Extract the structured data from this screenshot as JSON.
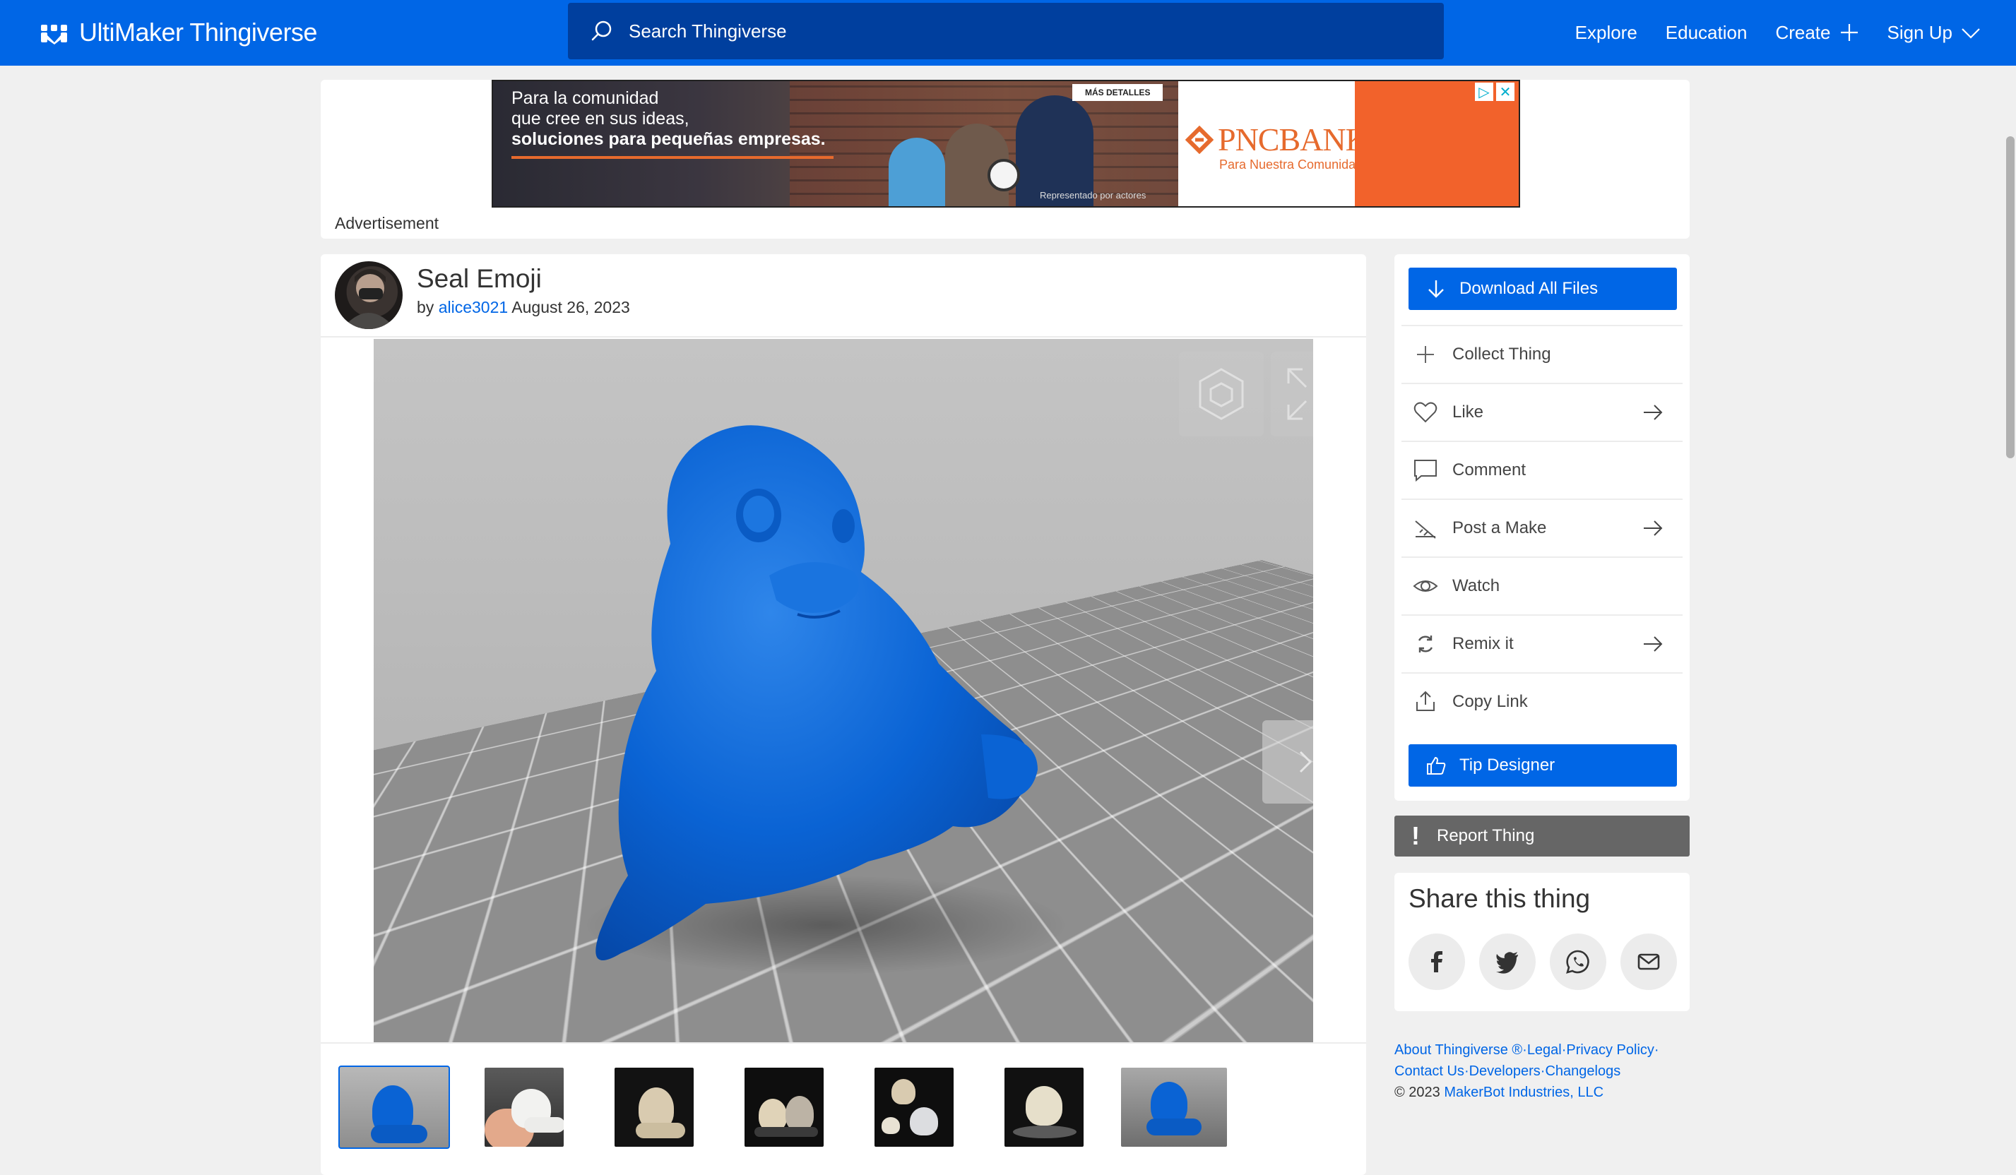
{
  "header": {
    "logo_text": "UltiMaker Thingiverse",
    "search_placeholder": "Search Thingiverse",
    "nav": {
      "explore": "Explore",
      "education": "Education",
      "create": "Create",
      "signup": "Sign Up"
    },
    "brand_color": "#0066e6"
  },
  "ad": {
    "line1": "Para la comunidad",
    "line2": "que cree en sus ideas,",
    "line3": "soluciones para pequeñas empresas.",
    "more_details": "MÁS DETALLES",
    "disclaimer": "Representado por actores",
    "brand": "PNCBANK",
    "brand_tagline": "Para Nuestra Comunidad",
    "label": "Advertisement"
  },
  "thing": {
    "title": "Seal Emoji",
    "by": "by",
    "author": "alice3021",
    "date": "August 26, 2023",
    "thumbnails": [
      {
        "kind": "render-blue",
        "active": true
      },
      {
        "kind": "photo-hand"
      },
      {
        "kind": "photo-dark"
      },
      {
        "kind": "photo-dark-pair"
      },
      {
        "kind": "photo-dark-trio"
      },
      {
        "kind": "photo-dark-plate"
      },
      {
        "kind": "render-blue-wide"
      }
    ]
  },
  "sidebar": {
    "download": "Download All Files",
    "collect": "Collect Thing",
    "like": "Like",
    "comment": "Comment",
    "post_make": "Post a Make",
    "watch": "Watch",
    "remix": "Remix it",
    "copy_link": "Copy Link",
    "tip": "Tip Designer",
    "report": "Report Thing"
  },
  "share": {
    "title": "Share this thing",
    "icons": [
      "facebook-icon",
      "twitter-icon",
      "whatsapp-icon",
      "email-icon"
    ]
  },
  "footer": {
    "about": "About Thingiverse ®",
    "legal": "Legal",
    "privacy": "Privacy Policy",
    "contact": "Contact Us",
    "developers": "Developers",
    "changelogs": "Changelogs",
    "copyright": "©  2023",
    "company": "MakerBot Industries, LLC",
    "sep": "·"
  }
}
